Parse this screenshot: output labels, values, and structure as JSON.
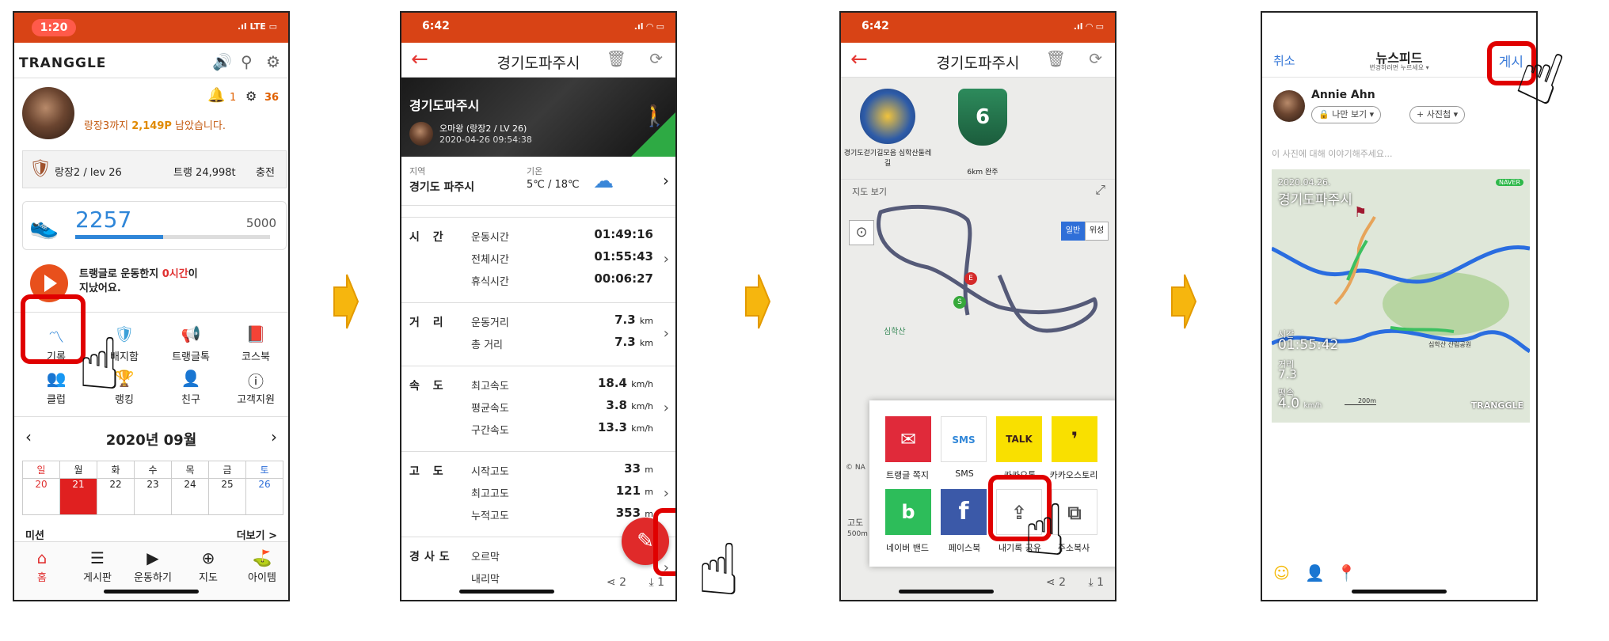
{
  "phone1": {
    "status_time": "1:20",
    "network": "LTE",
    "logo": "TRANGGLE",
    "rank_text_pre": "랑장3까지 ",
    "rank_points": "2,149P",
    "rank_text_post": " 남았습니다.",
    "notif_count": "1",
    "bike_count": "36",
    "level": "랑장2 / lev 26",
    "tramble": "트랭 24,998t",
    "charge": "충전",
    "steps": "2257",
    "step_goal": "5000",
    "motivate_pre": "트랭글로 운동한지 ",
    "motivate_hours": "0시간",
    "motivate_post": "이",
    "motivate_line2": "지났어요.",
    "grid": [
      "기록",
      "배지함",
      "트랭글톡",
      "코스북",
      "클럽",
      "랭킹",
      "친구",
      "고객지원"
    ],
    "month": "2020년 09월",
    "weekdays": [
      "일",
      "월",
      "화",
      "수",
      "목",
      "금",
      "토"
    ],
    "days": [
      "20",
      "21",
      "22",
      "23",
      "24",
      "25",
      "26"
    ],
    "mission": "미션",
    "more": "더보기 >",
    "nav": [
      "홈",
      "게시판",
      "운동하기",
      "지도",
      "아이템"
    ]
  },
  "phone2": {
    "status_time": "6:42",
    "title": "경기도파주시",
    "banner_title": "경기도파주시",
    "user": "오마왕 (랑장2 / LV 26)",
    "datetime": "2020-04-26 09:54:38",
    "region_label": "지역",
    "region": "경기도 파주시",
    "temp_label": "기온",
    "temp": "5℃ / 18℃",
    "sections": [
      {
        "cat": "시 간",
        "rows": [
          [
            "운동시간",
            "01:49:16",
            ""
          ],
          [
            "전체시간",
            "01:55:43",
            ""
          ],
          [
            "휴식시간",
            "00:06:27",
            ""
          ]
        ]
      },
      {
        "cat": "거 리",
        "rows": [
          [
            "운동거리",
            "7.3",
            "km"
          ],
          [
            "총 거리",
            "7.3",
            "km"
          ]
        ]
      },
      {
        "cat": "속 도",
        "rows": [
          [
            "최고속도",
            "18.4",
            "km/h"
          ],
          [
            "평균속도",
            "3.8",
            "km/h"
          ],
          [
            "구간속도",
            "13.3",
            "km/h"
          ]
        ]
      },
      {
        "cat": "고 도",
        "rows": [
          [
            "시작고도",
            "33",
            "m"
          ],
          [
            "최고고도",
            "121",
            "m"
          ],
          [
            "누적고도",
            "353",
            "m"
          ]
        ]
      },
      {
        "cat": "경사도",
        "rows": [
          [
            "오르막",
            "",
            ""
          ],
          [
            "내리막",
            "",
            ""
          ]
        ]
      }
    ],
    "share_count": "2",
    "download_count": "1"
  },
  "phone3": {
    "status_time": "6:42",
    "title": "경기도파주시",
    "badge1": "경기도걷기길모음 심학산둘레길",
    "badge2": "6km 완주",
    "map_label": "지도 보기",
    "map_tabs": [
      "일반",
      "위성"
    ],
    "map_poi": "심학산",
    "alt_label": "고도",
    "alt_val": "500m",
    "naver": "© NA",
    "share_items": [
      "트랭글 쪽지",
      "SMS",
      "카카오톡",
      "카카오스토리",
      "네이버 밴드",
      "페이스북",
      "내기록 공유",
      "주소복사"
    ],
    "share_count": "2",
    "download_count": "1"
  },
  "phone4": {
    "cancel": "취소",
    "title": "뉴스피드",
    "subtitle": "변경하려면 누르세요 ▾",
    "post": "게시",
    "user": "Annie Ahn",
    "privacy": "나만 보기 ▾",
    "album": "+ 사진첩 ▾",
    "placeholder": "이 사진에 대해 이야기해주세요...",
    "card_date": "2020.04.26.",
    "card_title": "경기도파주시",
    "naver": "NAVER",
    "time_label": "시간",
    "time_val": "01:55:42",
    "dist_label": "거리",
    "dist_val": "7.3",
    "speed_label": "평속",
    "speed_val": "4.0",
    "speed_unit": "km/h",
    "scale": "200m",
    "poi": "심학산 산림공원",
    "brand": "TRANGGLE"
  },
  "colors": {
    "brand": "#d84315",
    "accent_red": "#e00000",
    "arrow": "#f6b60e"
  }
}
